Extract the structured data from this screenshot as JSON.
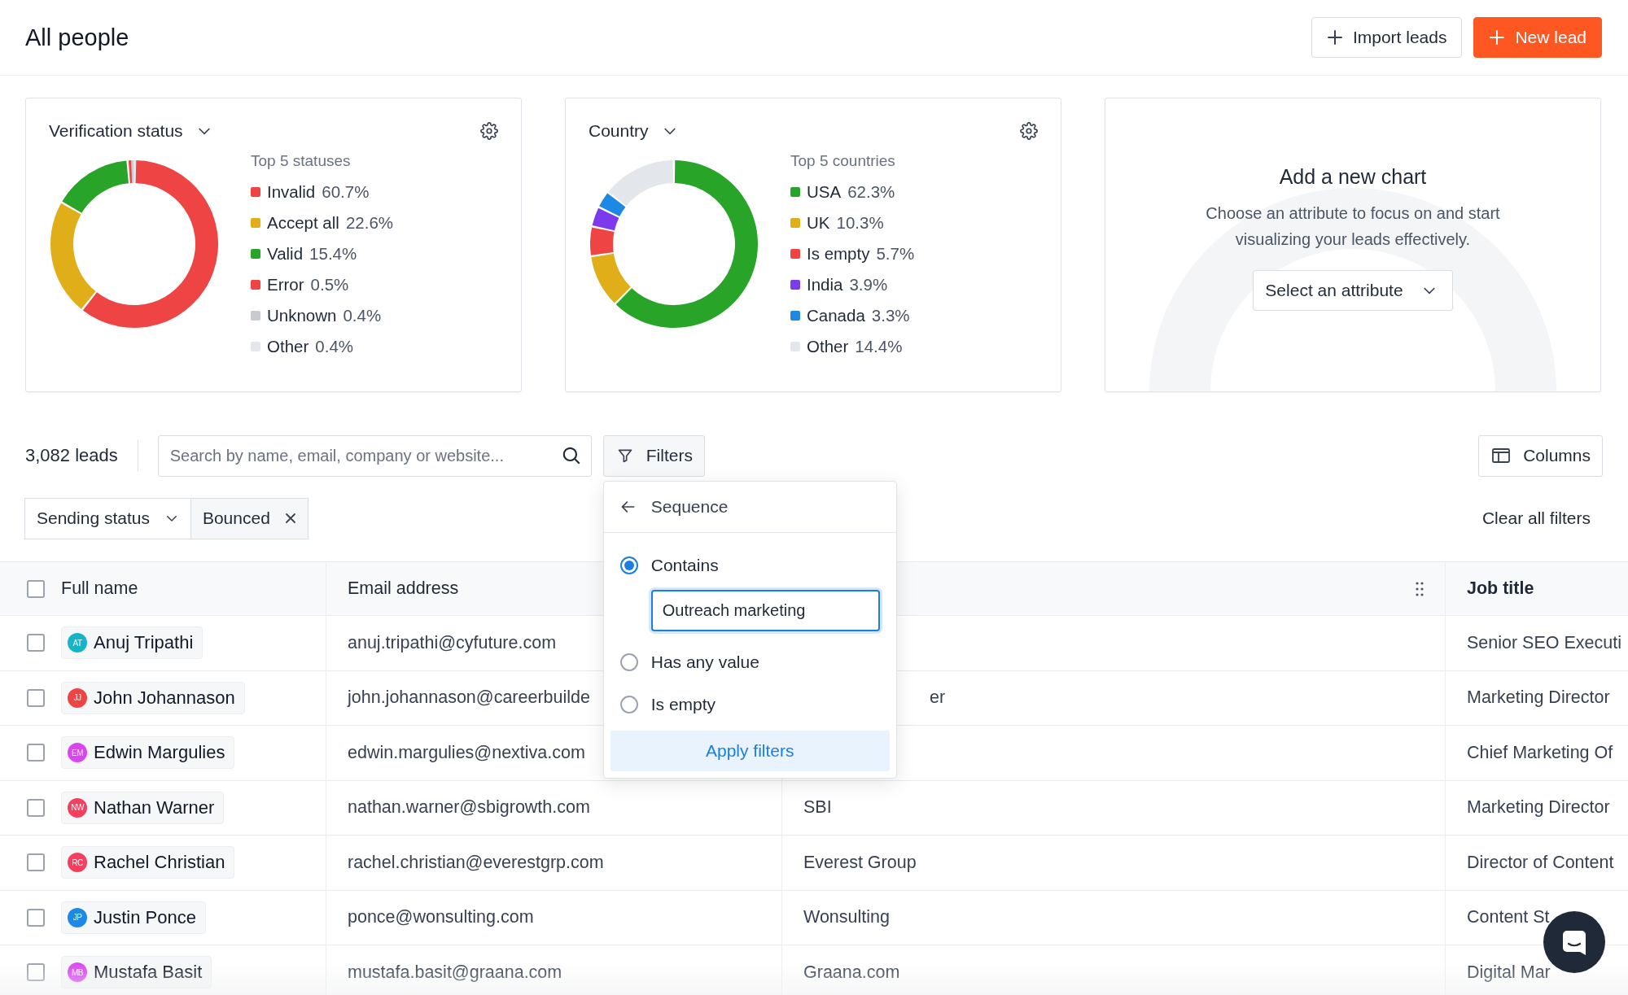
{
  "header": {
    "title": "All people",
    "buttons": [
      {
        "label": "Import leads",
        "kind": "secondary"
      },
      {
        "label": "New lead",
        "kind": "primary"
      }
    ]
  },
  "charts": [
    {
      "kind": "donut",
      "title": "Verification status",
      "legend_title": "Top 5 statuses",
      "legend": [
        {
          "value": "60.7%",
          "color": "#ef4444"
        },
        {
          "value": "22.6%",
          "color": "#e0ae18"
        },
        {
          "value": "15.4%",
          "color": "#28a428"
        },
        {
          "value": "0.5%",
          "color": "#ef4444"
        },
        {
          "value": "0.4%",
          "color": "#c6cad1"
        },
        {
          "value": "0.4%",
          "color": "#e3e6ea"
        }
      ],
      "chart_data": {
        "type": "donut",
        "categories": [
          "Invalid",
          "Accept all",
          "Valid",
          "Error",
          "Unknown",
          "Other"
        ],
        "values": [
          60.7,
          22.6,
          15.4,
          0.5,
          0.4,
          0.4
        ]
      }
    },
    {
      "kind": "donut",
      "title": "Country",
      "legend_title": "Top 5 countries",
      "legend": [
        {
          "value": "62.3%",
          "color": "#28a428"
        },
        {
          "value": "10.3%",
          "color": "#e0ae18"
        },
        {
          "value": "5.7%",
          "color": "#ef4444"
        },
        {
          "value": "3.9%",
          "color": "#7c3aed"
        },
        {
          "value": "3.3%",
          "color": "#1e88e5"
        },
        {
          "value": "14.4%",
          "color": "#e3e6ea"
        }
      ],
      "chart_data": {
        "type": "donut",
        "categories": [
          "USA",
          "UK",
          "Is empty",
          "India",
          "Canada",
          "Other"
        ],
        "values": [
          62.3,
          10.3,
          5.7,
          3.9,
          3.3,
          14.4
        ]
      }
    },
    {
      "kind": "empty",
      "title": "Add a new chart",
      "description": "Choose an attribute to focus on and start visualizing your leads effectively.",
      "select": "Select an attribute"
    }
  ],
  "toolbar": {
    "count": "3,082 leads",
    "search_placeholder": "Search by name, email, company or website...",
    "filters_button": "Filters",
    "columns_button": "Columns"
  },
  "filter_chips": [
    {
      "label": "Sending status",
      "kind": "select"
    },
    {
      "label": "Bounced",
      "kind": "value"
    }
  ],
  "clear_filters": "Clear all filters",
  "filter_menu": {
    "title": "Sequence",
    "options": [
      {
        "label": "Contains",
        "selected": true,
        "value": "Outreach marketing"
      },
      {
        "label": "Has any value",
        "selected": false
      },
      {
        "label": "Is empty",
        "selected": false
      }
    ],
    "apply": "Apply filters"
  },
  "table": {
    "header_checked": false,
    "columns": [
      "Full name",
      "Email address",
      "Job title"
    ],
    "rows": [
      {
        "checked": false,
        "initials": "AT",
        "color": "#17b3c6",
        "name": "Anuj Tripathi",
        "email": "anuj.tripathi@cyfuture.com",
        "job_title": "Senior SEO Executi"
      },
      {
        "checked": false,
        "initials": "JJ",
        "color": "#ef4444",
        "name": "John Johannason",
        "email": "john.johannason@careerbuilde",
        "company": "er",
        "company_clipped": true,
        "job_title": "Marketing Director"
      },
      {
        "checked": false,
        "initials": "EM",
        "color": "#d946ef",
        "name": "Edwin Margulies",
        "email": "edwin.margulies@nextiva.com",
        "job_title": "Chief Marketing Of"
      },
      {
        "checked": false,
        "initials": "NW",
        "color": "#f43f5e",
        "name": "Nathan Warner",
        "email": "nathan.warner@sbigrowth.com",
        "company": "SBI",
        "job_title": "Marketing Director"
      },
      {
        "checked": false,
        "initials": "RC",
        "color": "#f43f5e",
        "name": "Rachel Christian",
        "email": "rachel.christian@everestgrp.com",
        "company": "Everest Group",
        "job_title": "Director of Content"
      },
      {
        "checked": false,
        "initials": "JP",
        "color": "#1e88e5",
        "name": "Justin Ponce",
        "email": "ponce@wonsulting.com",
        "company": "Wonsulting",
        "job_title": "Content St"
      },
      {
        "checked": false,
        "initials": "MB",
        "color": "#d946ef",
        "name": "Mustafa Basit",
        "email": "mustafa.basit@graana.com",
        "company": "Graana.com",
        "job_title": "Digital Mar"
      }
    ]
  }
}
